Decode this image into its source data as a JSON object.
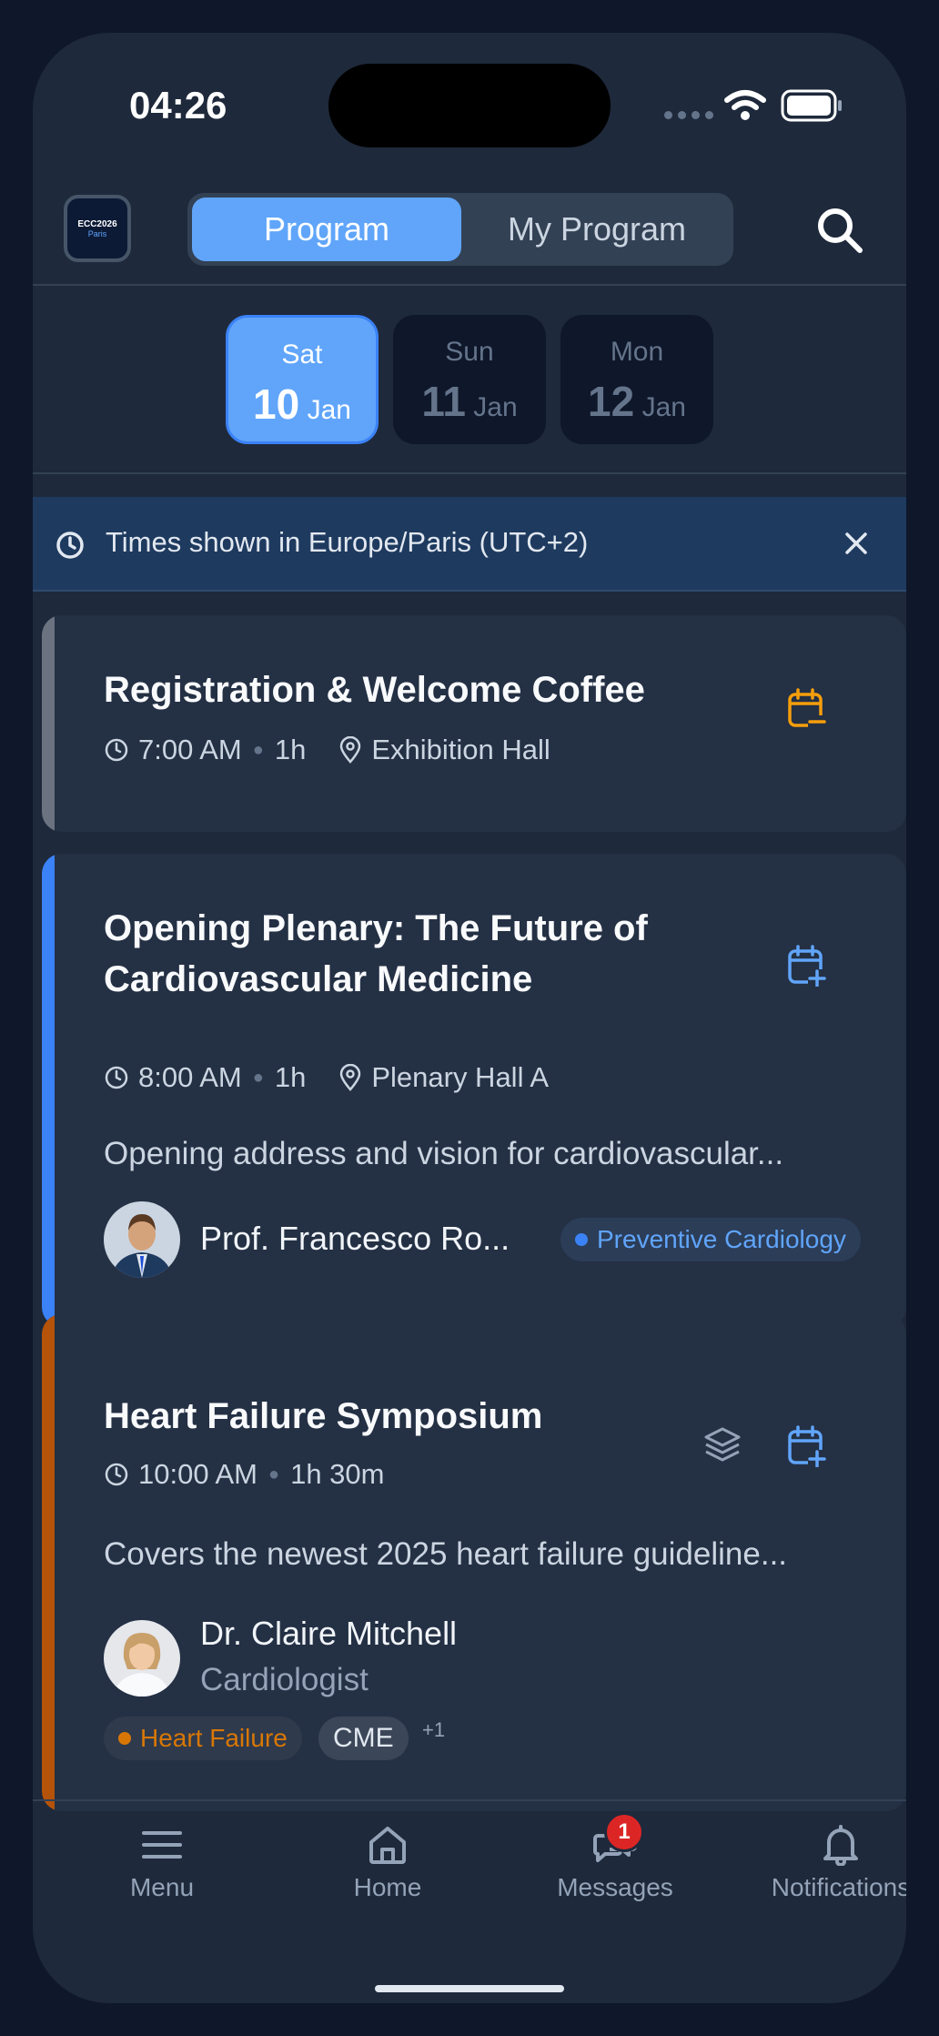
{
  "status_bar": {
    "time": "04:26"
  },
  "header": {
    "logo": {
      "line1": "ECC2026",
      "line2": "Paris"
    },
    "tabs": [
      "Program",
      "My Program"
    ]
  },
  "dates": [
    {
      "weekday": "Sat",
      "day": "10",
      "month": "Jan",
      "selected": true
    },
    {
      "weekday": "Sun",
      "day": "11",
      "month": "Jan",
      "selected": false
    },
    {
      "weekday": "Mon",
      "day": "12",
      "month": "Jan",
      "selected": false
    }
  ],
  "timezone_banner": {
    "text": "Times shown in Europe/Paris (UTC+2)"
  },
  "sessions": [
    {
      "title": "Registration & Welcome Coffee",
      "time": "7:00 AM",
      "duration": "1h",
      "location": "Exhibition Hall",
      "accent": "#6b7280",
      "calendar_icon": "calendar-minus-icon",
      "calendar_color": "#f59e0b"
    },
    {
      "title_line1": "Opening Plenary: The Future of",
      "title_line2": "Cardiovascular Medicine",
      "time": "8:00 AM",
      "duration": "1h",
      "location": "Plenary Hall A",
      "description": "Opening address and vision for cardiovascular...",
      "speaker": "Prof. Francesco Ro...",
      "tag": "Preventive Cardiology",
      "accent": "#3b82f6",
      "calendar_icon": "calendar-plus-icon",
      "calendar_color": "#60a5fa"
    },
    {
      "title": "Heart Failure Symposium",
      "time": "10:00 AM",
      "duration": "1h 30m",
      "description": "Covers the newest 2025 heart failure guideline...",
      "speaker": "Dr. Claire Mitchell",
      "speaker_role": "Cardiologist",
      "tags": [
        "Heart Failure",
        "CME"
      ],
      "more_tags": "+1",
      "accent": "#b45309",
      "calendar_icon": "calendar-plus-icon",
      "calendar_color": "#60a5fa"
    }
  ],
  "bottom_nav": [
    {
      "label": "Menu",
      "icon": "menu-icon"
    },
    {
      "label": "Home",
      "icon": "home-icon"
    },
    {
      "label": "Messages",
      "icon": "messages-icon",
      "badge": "1"
    },
    {
      "label": "Notifications",
      "icon": "bell-icon"
    }
  ]
}
